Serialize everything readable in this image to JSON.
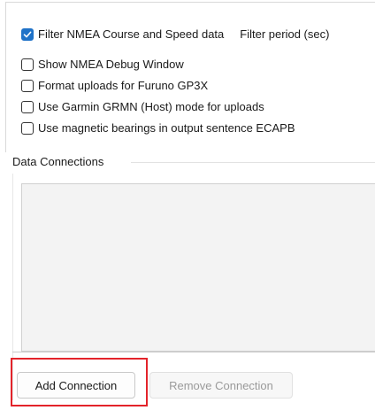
{
  "options": {
    "filter_nmea": {
      "label": "Filter NMEA Course and Speed data",
      "checked": true
    },
    "filter_period_label": "Filter period (sec)",
    "items": [
      {
        "label": "Show NMEA Debug Window",
        "checked": false
      },
      {
        "label": "Format uploads for Furuno GP3X",
        "checked": false
      },
      {
        "label": "Use Garmin GRMN (Host) mode for uploads",
        "checked": false
      },
      {
        "label": "Use magnetic bearings in output sentence ECAPB",
        "checked": false
      }
    ]
  },
  "connections": {
    "section_label": "Data Connections",
    "add_button": "Add Connection",
    "remove_button": "Remove Connection"
  },
  "colors": {
    "checkbox_accent": "#1f72c8",
    "highlight": "#e3232a"
  },
  "icons": {
    "checkmark": "checkmark-icon"
  }
}
